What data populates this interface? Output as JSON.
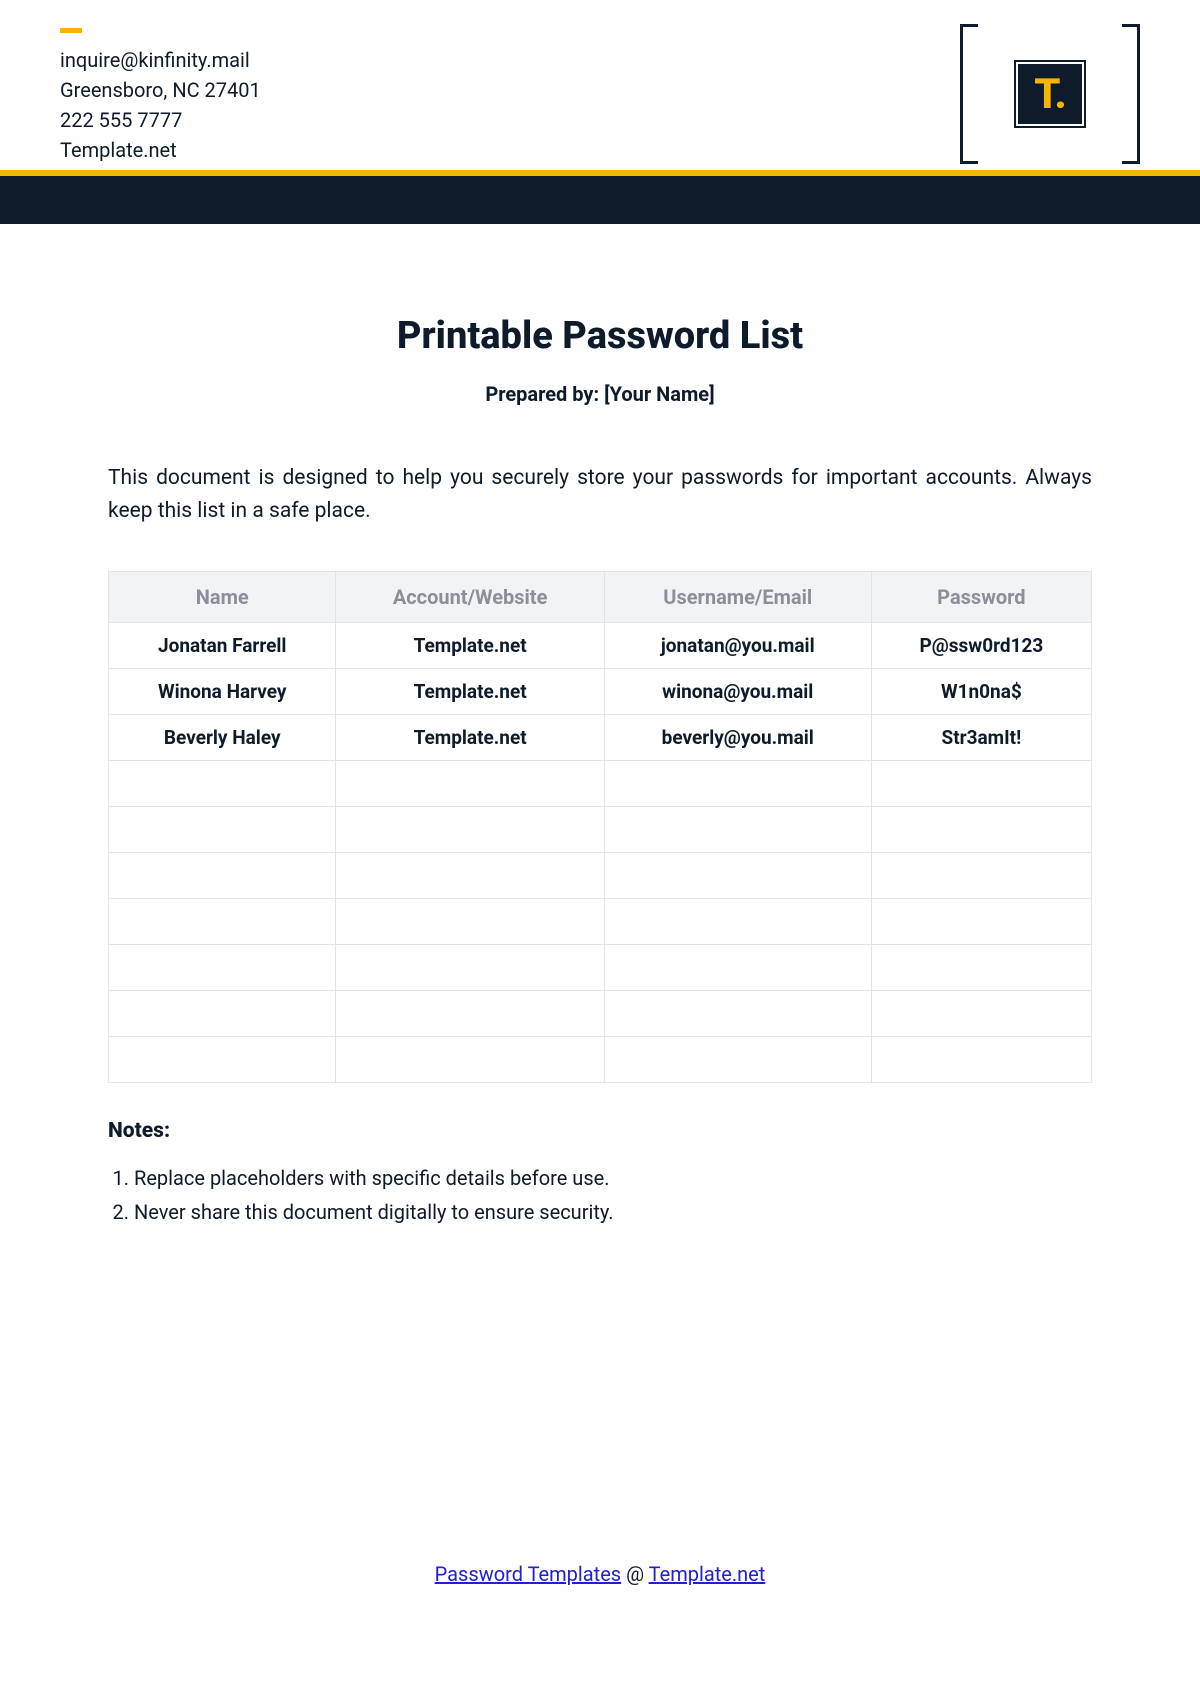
{
  "header": {
    "contact": {
      "email": "inquire@kinfinity.mail",
      "address": "Greensboro, NC 27401",
      "phone": "222 555 7777",
      "site": "Template.net"
    },
    "logo_text": "T."
  },
  "title": "Printable Password List",
  "prepared_by_label": "Prepared by: [Your Name]",
  "intro": "This document is designed to help you securely store your passwords for important accounts. Always keep this list in a safe place.",
  "table": {
    "headers": [
      "Name",
      "Account/Website",
      "Username/Email",
      "Password"
    ],
    "rows": [
      {
        "name": "Jonatan Farrell",
        "account": "Template.net",
        "user": "jonatan@you.mail",
        "password": "P@ssw0rd123"
      },
      {
        "name": "Winona Harvey",
        "account": "Template.net",
        "user": "winona@you.mail",
        "password": "W1n0na$"
      },
      {
        "name": "Beverly Haley",
        "account": "Template.net",
        "user": "beverly@you.mail",
        "password": "Str3amIt!"
      }
    ],
    "empty_rows": 7
  },
  "notes_heading": "Notes:",
  "notes": [
    "Replace placeholders with specific details before use.",
    "Never share this document digitally to ensure security."
  ],
  "footer": {
    "link1_text": "Password Templates",
    "separator": " @ ",
    "link2_text": "Template.net"
  }
}
